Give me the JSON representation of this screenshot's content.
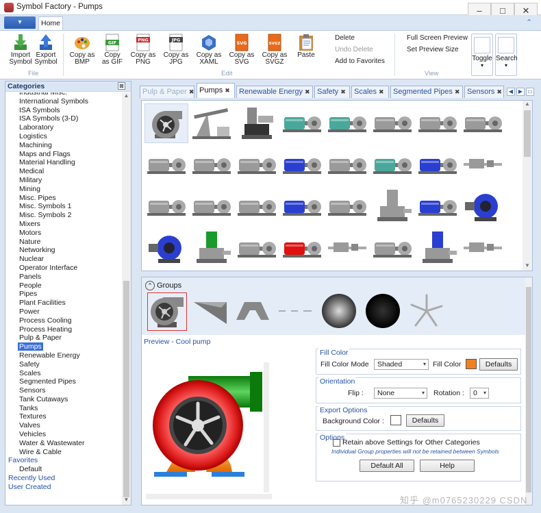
{
  "window": {
    "title": "Symbol Factory - Pumps",
    "minimize": "–",
    "maximize": "□",
    "close": "✕"
  },
  "ribbon_tabs": {
    "home": "Home"
  },
  "ribbon": {
    "file_group": {
      "label": "File",
      "buttons": [
        {
          "id": "import",
          "label1": "Import",
          "label2": "Symbol",
          "icon": "import-arrow-icon"
        },
        {
          "id": "export",
          "label1": "Export",
          "label2": "Symbol",
          "icon": "export-arrow-icon"
        }
      ]
    },
    "edit_group": {
      "label": "Edit",
      "buttons": [
        {
          "id": "copy-bmp",
          "label1": "Copy as",
          "label2": "BMP",
          "icon": "palette-icon"
        },
        {
          "id": "copy-gif",
          "label1": "Copy",
          "label2": "as GIF",
          "icon": "gif-file-icon",
          "badge": "GIF"
        },
        {
          "id": "copy-png",
          "label1": "Copy as",
          "label2": "PNG",
          "icon": "png-file-icon",
          "badge": "PNG"
        },
        {
          "id": "copy-jpg",
          "label1": "Copy as",
          "label2": "JPG",
          "icon": "jpg-file-icon",
          "badge": "JPG"
        },
        {
          "id": "copy-xaml",
          "label1": "Copy as",
          "label2": "XAML",
          "icon": "xaml-icon"
        },
        {
          "id": "copy-svg",
          "label1": "Copy as",
          "label2": "SVG",
          "icon": "svg-file-icon",
          "badge": "SVG"
        },
        {
          "id": "copy-svgz",
          "label1": "Copy as",
          "label2": "SVGZ",
          "icon": "svgz-file-icon",
          "badge": "SVGZ"
        },
        {
          "id": "paste",
          "label1": "Paste",
          "label2": "",
          "icon": "paste-icon"
        }
      ],
      "delete": "Delete",
      "undo_delete": "Undo Delete",
      "add_favorites": "Add to Favorites"
    },
    "view_group": {
      "label": "View",
      "full_screen": "Full Screen Preview",
      "preview_size": "Set Preview Size",
      "toggle": "Toggle",
      "search": "Search"
    },
    "colors": {
      "accent": "#2b5cb0"
    }
  },
  "categories": {
    "header": "Categories",
    "items": [
      "Industrial Misc.",
      "International Symbols",
      "ISA Symbols",
      "ISA Symbols (3-D)",
      "Laboratory",
      "Logistics",
      "Machining",
      "Maps and Flags",
      "Material Handling",
      "Medical",
      "Military",
      "Mining",
      "Misc. Pipes",
      "Misc. Symbols 1",
      "Misc. Symbols 2",
      "Mixers",
      "Motors",
      "Nature",
      "Networking",
      "Nuclear",
      "Operator Interface",
      "Panels",
      "People",
      "Pipes",
      "Plant Facilities",
      "Power",
      "Process Cooling",
      "Process Heating",
      "Pulp & Paper",
      "Pumps",
      "Renewable Energy",
      "Safety",
      "Scales",
      "Segmented Pipes",
      "Sensors",
      "Tank Cutaways",
      "Tanks",
      "Textures",
      "Valves",
      "Vehicles",
      "Water & Wastewater",
      "Wire & Cable"
    ],
    "selected": "Pumps",
    "favorites": "Favorites",
    "favorites_items": [
      "Default"
    ],
    "recently_used": "Recently Used",
    "user_created": "User Created"
  },
  "doc_tabs": [
    {
      "label": "Pulp & Paper",
      "active": false,
      "faded": true
    },
    {
      "label": "Pumps",
      "active": true,
      "faded": false
    },
    {
      "label": "Renewable Energy",
      "active": false,
      "faded": false
    },
    {
      "label": "Safety",
      "active": false,
      "faded": false
    },
    {
      "label": "Scales",
      "active": false,
      "faded": false
    },
    {
      "label": "Segmented Pipes",
      "active": false,
      "faded": false
    },
    {
      "label": "Sensors",
      "active": false,
      "faded": false
    }
  ],
  "symbol_grid": {
    "rows": [
      [
        "cool-pump",
        "pump-jack",
        "vertical-pump",
        "teal-motor-pump",
        "teal-motor-pump-2",
        "gray-motor-pump",
        "gray-motor-pump-2",
        "gray-inline-pump"
      ],
      [
        "gear-pump",
        "cylinder-pump",
        "pedestal-pump",
        "blue-pump",
        "pipe-pump",
        "teal-base-pump",
        "blue-motor-pump",
        "small-inline-pump"
      ],
      [
        "skid-pump",
        "shaft-pump",
        "wide-pump",
        "blue-motor-pump-2",
        "long-motor-pump",
        "vertical-motor-pump",
        "blue-small-pump",
        "blue-volute-pump"
      ],
      [
        "blue-gear-motor",
        "green-vertical-pump",
        "gray-casing-pump",
        "red-motor-pump",
        "thin-shaft-pump",
        "gray-body-pump",
        "blue-vertical-pump",
        "small-gray-pump"
      ]
    ],
    "selected": "cool-pump"
  },
  "groups": {
    "label": "Groups",
    "items": [
      "cool-pump",
      "wedge",
      "trapezoid",
      "dash-line",
      "gray-sphere",
      "black-sphere",
      "impeller-blades"
    ]
  },
  "preview": {
    "label": "Preview - Cool pump"
  },
  "fill_color": {
    "title": "Fill Color",
    "mode_label": "Fill Color Mode",
    "mode_value": "Shaded",
    "color_label": "Fill Color",
    "color": "#f08020",
    "defaults": "Defaults"
  },
  "orientation": {
    "title": "Orientation",
    "flip_label": "Flip :",
    "flip_value": "None",
    "rotation_label": "Rotation :",
    "rotation_value": "0"
  },
  "export_options": {
    "title": "Export Options",
    "bg_label": "Background Color :",
    "bg_color": "#ffffff",
    "defaults": "Defaults"
  },
  "options": {
    "title": "Options",
    "retain_label": "Retain above Settings for Other Categories",
    "retain_checked": false,
    "note": "Individual Group properties will not be retained between Symbols",
    "default_all": "Default All",
    "help": "Help"
  },
  "watermark": "知乎 @m0765230229 CSDN"
}
